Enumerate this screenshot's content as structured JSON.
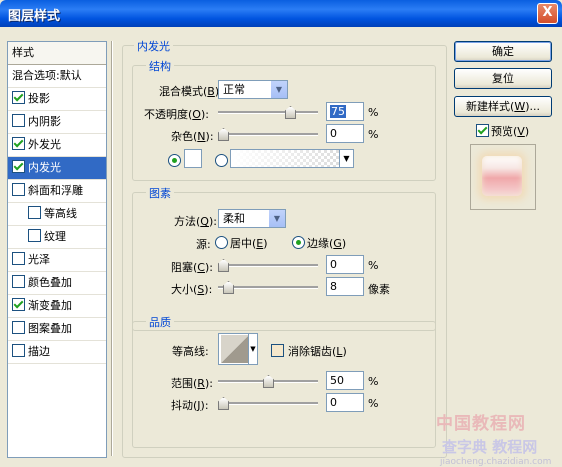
{
  "window": {
    "title": "图层样式",
    "close": "X"
  },
  "style_list": {
    "header": "样式",
    "items": [
      {
        "label": "混合选项:默认",
        "checkbox": false,
        "checked": false,
        "selected": false,
        "indent": false
      },
      {
        "label": "投影",
        "checkbox": true,
        "checked": true,
        "selected": false,
        "indent": false
      },
      {
        "label": "内阴影",
        "checkbox": true,
        "checked": false,
        "selected": false,
        "indent": false
      },
      {
        "label": "外发光",
        "checkbox": true,
        "checked": true,
        "selected": false,
        "indent": false
      },
      {
        "label": "内发光",
        "checkbox": true,
        "checked": true,
        "selected": true,
        "indent": false
      },
      {
        "label": "斜面和浮雕",
        "checkbox": true,
        "checked": false,
        "selected": false,
        "indent": false
      },
      {
        "label": "等高线",
        "checkbox": true,
        "checked": false,
        "selected": false,
        "indent": true
      },
      {
        "label": "纹理",
        "checkbox": true,
        "checked": false,
        "selected": false,
        "indent": true
      },
      {
        "label": "光泽",
        "checkbox": true,
        "checked": false,
        "selected": false,
        "indent": false
      },
      {
        "label": "颜色叠加",
        "checkbox": true,
        "checked": false,
        "selected": false,
        "indent": false
      },
      {
        "label": "渐变叠加",
        "checkbox": true,
        "checked": true,
        "selected": false,
        "indent": false
      },
      {
        "label": "图案叠加",
        "checkbox": true,
        "checked": false,
        "selected": false,
        "indent": false
      },
      {
        "label": "描边",
        "checkbox": true,
        "checked": false,
        "selected": false,
        "indent": false
      }
    ]
  },
  "panel": {
    "title": "内发光",
    "structure": {
      "title": "结构",
      "blend_mode": {
        "label": "混合模式",
        "key": "B",
        "value": "正常"
      },
      "opacity": {
        "label": "不透明度",
        "key": "O",
        "value": "75",
        "unit": "%",
        "fraction": 0.75
      },
      "noise": {
        "label": "杂色",
        "key": "N",
        "value": "0",
        "unit": "%",
        "fraction": 0.0
      }
    },
    "elements": {
      "title": "图素",
      "method": {
        "label": "方法",
        "key": "Q",
        "value": "柔和"
      },
      "source": {
        "label": "源",
        "center": {
          "label": "居中",
          "key": "E"
        },
        "edge": {
          "label": "边缘",
          "key": "G"
        }
      },
      "choke": {
        "label": "阻塞",
        "key": "C",
        "value": "0",
        "unit": "%",
        "fraction": 0.0
      },
      "size": {
        "label": "大小",
        "key": "S",
        "value": "8",
        "unit": "像素",
        "fraction": 0.06
      }
    },
    "quality": {
      "title": "品质",
      "contour": {
        "label": "等高线"
      },
      "antialias": {
        "label": "消除锯齿",
        "key": "L"
      },
      "range": {
        "label": "范围",
        "key": "R",
        "value": "50",
        "unit": "%",
        "fraction": 0.5
      },
      "jitter": {
        "label": "抖动",
        "key": "J",
        "value": "0",
        "unit": "%",
        "fraction": 0.0
      }
    }
  },
  "buttons": {
    "ok": "确定",
    "reset": "复位",
    "new_style": {
      "label": "新建样式",
      "key": "W"
    },
    "preview": {
      "label": "预览",
      "key": "V",
      "checked": true
    }
  },
  "watermark": {
    "line1": "中国教程网",
    "line2": "查字典 教程网",
    "line3": "jiaocheng.chazidian.com"
  }
}
